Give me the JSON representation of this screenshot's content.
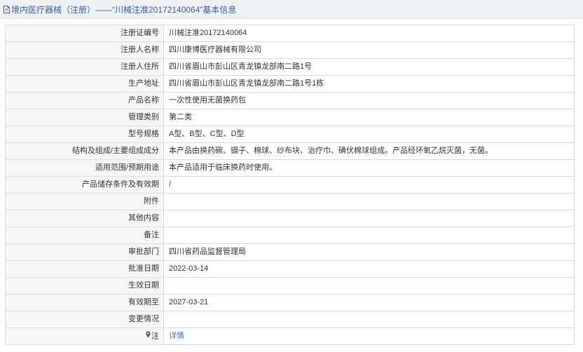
{
  "header": {
    "title": "境内医疗器械（注册）——“川械注准20172140064”基本信息",
    "icon": "document-icon"
  },
  "rows": [
    {
      "label": "注册证编号",
      "value": "川械注准20172140064"
    },
    {
      "label": "注册人名称",
      "value": "四川康博医疗器械有限公司"
    },
    {
      "label": "注册人住所",
      "value": "四川省眉山市彭山区青龙镇龙部南二路1号"
    },
    {
      "label": "生产地址",
      "value": "四川省眉山市彭山区青龙镇龙部南二路1号1栋"
    },
    {
      "label": "产品名称",
      "value": "一次性使用无菌换药包"
    },
    {
      "label": "管理类别",
      "value": "第二类"
    },
    {
      "label": "型号规格",
      "value": "A型、B型、C型、D型"
    },
    {
      "label": "结构及组成/主要组成成分",
      "value": "本产品由换药碗、镊子、棉球、纱布块、治疗巾、碘伏棉球组成。产品经环氧乙烷灭菌，无菌。"
    },
    {
      "label": "适用范围/预期用途",
      "value": "本产品适用于临床换药时使用。"
    },
    {
      "label": "产品储存条件及有效期",
      "value": "/"
    },
    {
      "label": "附件",
      "value": ""
    },
    {
      "label": "其他内容",
      "value": ""
    },
    {
      "label": "备注",
      "value": ""
    },
    {
      "label": "审批部门",
      "value": "四川省药品监督管理局"
    },
    {
      "label": "批准日期",
      "value": "2022-03-14"
    },
    {
      "label": "生效日期",
      "value": ""
    },
    {
      "label": "有效期至",
      "value": "2027-03-21"
    },
    {
      "label": "变更情况",
      "value": ""
    }
  ],
  "note_row": {
    "label": "注",
    "icon": "map-pin-icon",
    "link": "详情"
  }
}
